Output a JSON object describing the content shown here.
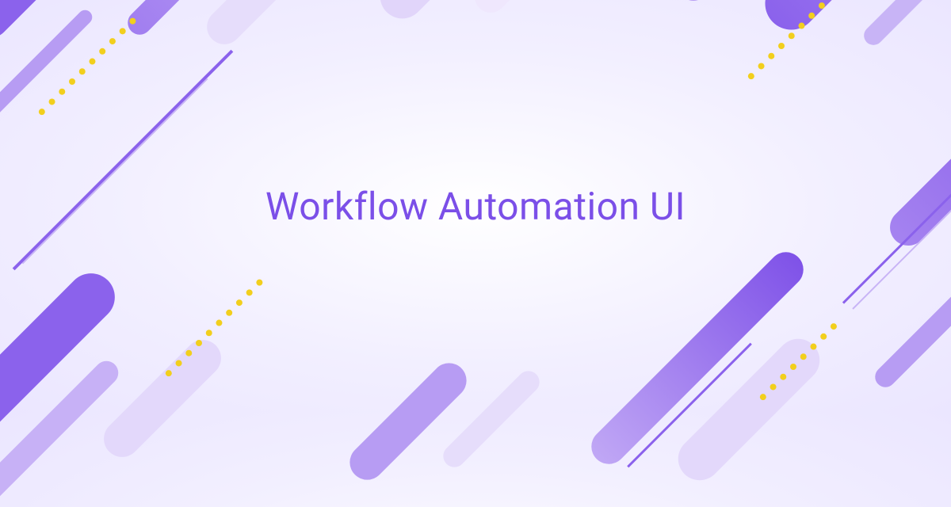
{
  "title": "Workflow Automation UI",
  "colors": {
    "accent": "#7b4fe8",
    "dot": "#f2cf1d"
  }
}
